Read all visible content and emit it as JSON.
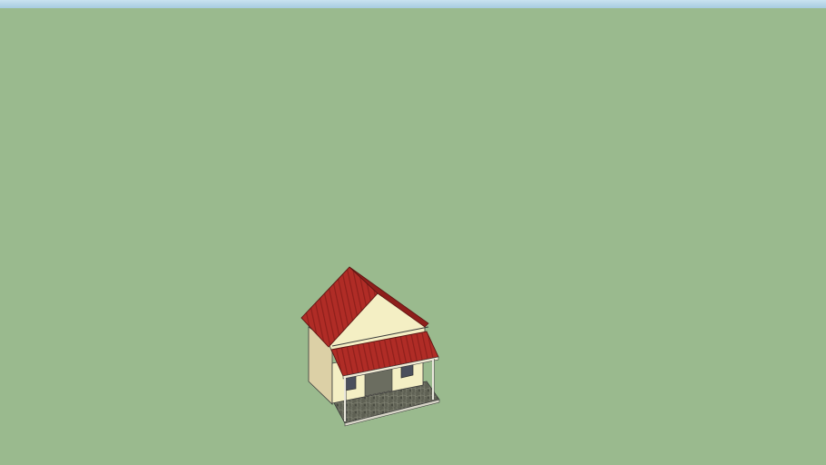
{
  "scene": {
    "colors": {
      "sky": "#a7cbe0",
      "ground": "#9aba8e",
      "roof": "#b02c26",
      "roof_shade": "#8e1f1b",
      "wall_front": "#f4efc4",
      "wall_side": "#dcd0a6",
      "porch_floor": "#5d5f52",
      "window": "#4a4f5c",
      "edge": "#3b3b3b"
    }
  }
}
